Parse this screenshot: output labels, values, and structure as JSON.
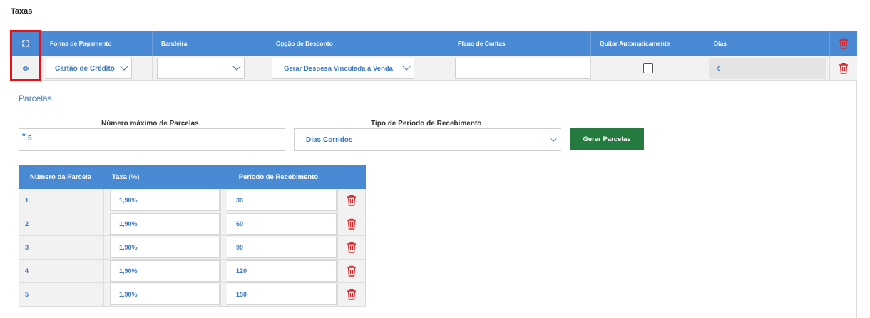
{
  "section_title": "Taxas",
  "main_table": {
    "headers": [
      "Forma de Pagamento",
      "Bandeira",
      "Opção de Desconto",
      "Plano de Contas",
      "Quitar Automaticamente",
      "Dias"
    ],
    "row": {
      "forma_pagamento": "Cartão de Crédito",
      "bandeira": "",
      "opcao_desconto": "Gerar Despesa Vinculada à Venda",
      "plano_contas": "",
      "quitar_automaticamente": false,
      "dias": "0"
    }
  },
  "parcelas": {
    "title": "Parcelas",
    "max_parcelas_label": "Número máximo de Parcelas",
    "max_parcelas_value": "5",
    "required_mark": "*",
    "tipo_periodo_label": "Tipo de Período de Recebimento",
    "tipo_periodo_value": "Dias Corridos",
    "gerar_button": "Gerar Parcelas",
    "table": {
      "headers": [
        "Número da Parcela",
        "Taxa (%)",
        "Período de Recebimento",
        ""
      ],
      "rows": [
        {
          "numero": "1",
          "taxa": "1,90%",
          "periodo": "30"
        },
        {
          "numero": "2",
          "taxa": "1,90%",
          "periodo": "60"
        },
        {
          "numero": "3",
          "taxa": "1,90%",
          "periodo": "90"
        },
        {
          "numero": "4",
          "taxa": "1,90%",
          "periodo": "120"
        },
        {
          "numero": "5",
          "taxa": "1,90%",
          "periodo": "150"
        }
      ]
    }
  },
  "colors": {
    "header_blue": "#4a89d4",
    "value_blue": "#3a78c2",
    "delete_red": "#d9262c",
    "highlight_red": "#e8111a",
    "button_green": "#247a3f"
  }
}
